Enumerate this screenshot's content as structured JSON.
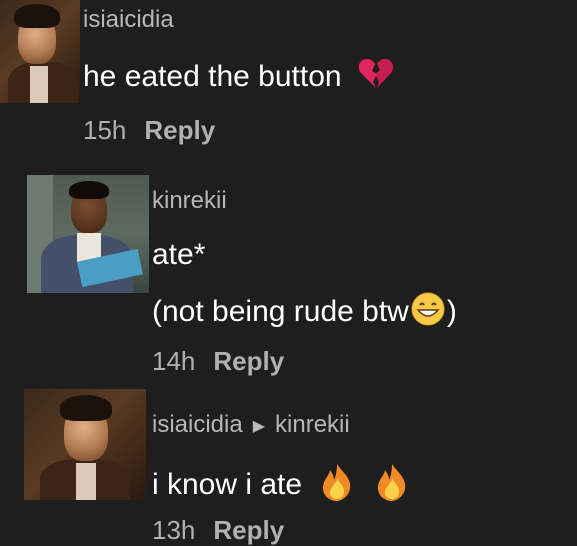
{
  "comments": [
    {
      "username": "isiaicidia",
      "text": "he eated the button",
      "emoji": "broken-heart-icon",
      "time": "15h",
      "reply_label": "Reply"
    },
    {
      "username": "kinrekii",
      "line1": "ate*",
      "line2": "(not being rude btw",
      "line2_end": ")",
      "emoji": "grinning-face-icon",
      "time": "14h",
      "reply_label": "Reply"
    },
    {
      "username": "isiaicidia",
      "reply_to": "kinrekii",
      "text": "i know i ate",
      "emoji": "fire-icon",
      "time": "13h",
      "reply_label": "Reply"
    }
  ],
  "colors": {
    "background": "#1e1e1e",
    "username": "#b8b8b8",
    "text": "#ffffff",
    "meta": "#b0b0b0"
  }
}
